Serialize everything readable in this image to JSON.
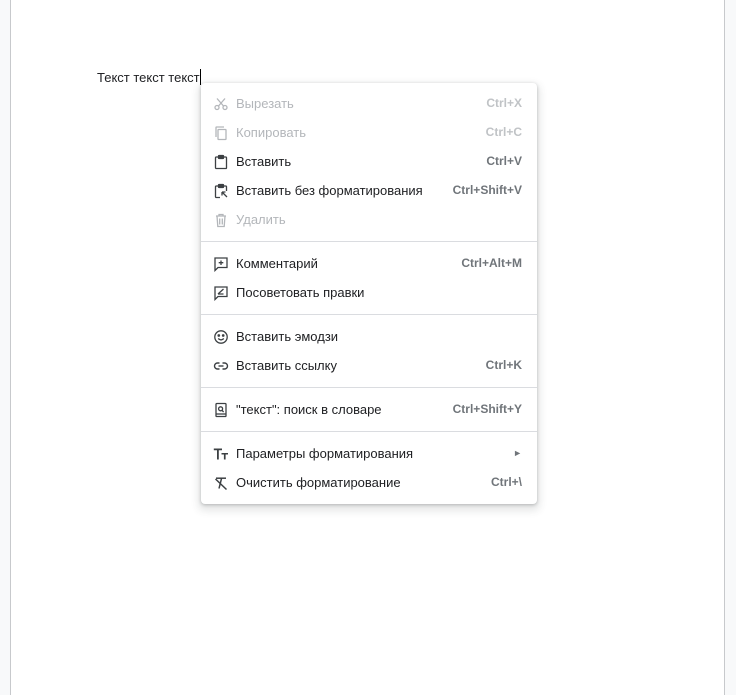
{
  "document": {
    "text": "Текст текст текст"
  },
  "context_menu": {
    "groups": [
      [
        {
          "label": "Вырезать",
          "shortcut": "Ctrl+X",
          "icon": "scissors-icon",
          "disabled": true
        },
        {
          "label": "Копировать",
          "shortcut": "Ctrl+C",
          "icon": "copy-icon",
          "disabled": true
        },
        {
          "label": "Вставить",
          "shortcut": "Ctrl+V",
          "icon": "paste-icon",
          "disabled": false
        },
        {
          "label": "Вставить без форматирования",
          "shortcut": "Ctrl+Shift+V",
          "icon": "paste-plain-icon",
          "disabled": false
        },
        {
          "label": "Удалить",
          "shortcut": "",
          "icon": "trash-icon",
          "disabled": true
        }
      ],
      [
        {
          "label": "Комментарий",
          "shortcut": "Ctrl+Alt+M",
          "icon": "add-comment-icon",
          "disabled": false
        },
        {
          "label": "Посоветовать правки",
          "shortcut": "",
          "icon": "suggest-edits-icon",
          "disabled": false
        }
      ],
      [
        {
          "label": "Вставить эмодзи",
          "shortcut": "",
          "icon": "emoji-icon",
          "disabled": false
        },
        {
          "label": "Вставить ссылку",
          "shortcut": "Ctrl+K",
          "icon": "link-icon",
          "disabled": false
        }
      ],
      [
        {
          "label": "\"текст\": поиск в словаре",
          "shortcut": "Ctrl+Shift+Y",
          "icon": "dictionary-icon",
          "disabled": false
        }
      ],
      [
        {
          "label": "Параметры форматирования",
          "shortcut": "",
          "icon": "text-format-icon",
          "disabled": false,
          "submenu": true
        },
        {
          "label": "Очистить форматирование",
          "shortcut": "Ctrl+\\",
          "icon": "clear-format-icon",
          "disabled": false
        }
      ]
    ],
    "submenu_arrow": "►"
  },
  "colors": {
    "text": "#202124",
    "disabled_text": "#b3b6ba",
    "shortcut": "#70757a",
    "separator": "#dadce0"
  }
}
